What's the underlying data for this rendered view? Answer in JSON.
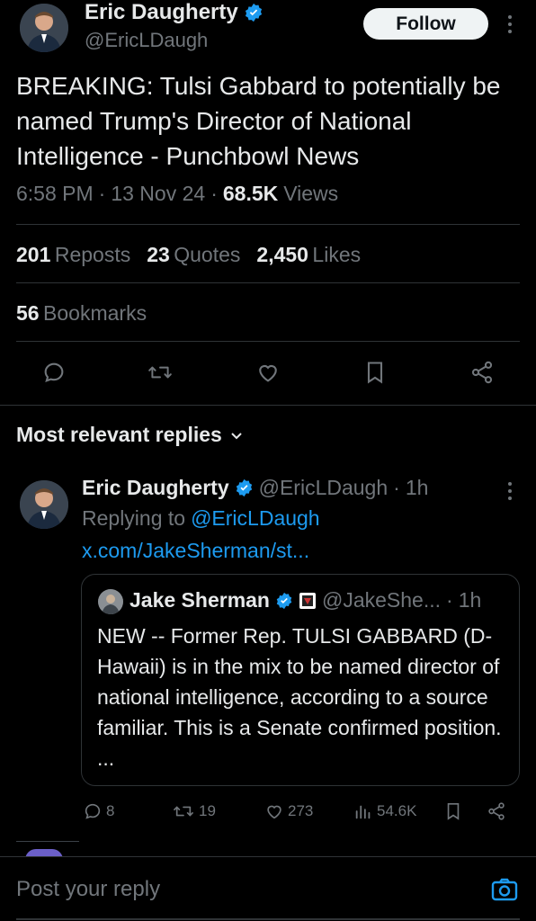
{
  "tweet": {
    "author_name": "Eric Daugherty",
    "author_handle": "@EricLDaugh",
    "follow_label": "Follow",
    "text": "BREAKING: Tulsi Gabbard to potentially be named Trump's Director of National Intelligence - Punchbowl News",
    "time": "6:58 PM",
    "date": "13 Nov 24",
    "views_count": "68.5K",
    "views_label": "Views",
    "reposts_count": "201",
    "reposts_label": "Reposts",
    "quotes_count": "23",
    "quotes_label": "Quotes",
    "likes_count": "2,450",
    "likes_label": "Likes",
    "bookmarks_count": "56",
    "bookmarks_label": "Bookmarks"
  },
  "replies_header": "Most relevant replies",
  "reply": {
    "author_name": "Eric Daugherty",
    "author_handle": "@EricLDaugh",
    "time_ago": "1h",
    "replying_to_label": "Replying to",
    "replying_to_handle": "@EricLDaugh",
    "link": "x.com/JakeSherman/st...",
    "quote": {
      "author_name": "Jake Sherman",
      "author_handle": "@JakeShe...",
      "time_ago": "1h",
      "text": "NEW -- Former Rep. TULSI GABBARD (D-Hawaii) is in the mix to be named director of national intelligence, according to a source familiar. This is a Senate confirmed position. ..."
    },
    "replies_count": "8",
    "reposts_count": "19",
    "likes_count": "273",
    "views_count": "54.6K"
  },
  "composer": {
    "placeholder": "Post your reply"
  },
  "colors": {
    "background": "#000000",
    "text": "#e7e9ea",
    "muted": "#71767b",
    "accent": "#1d9bf0",
    "divider": "#2f3336"
  }
}
